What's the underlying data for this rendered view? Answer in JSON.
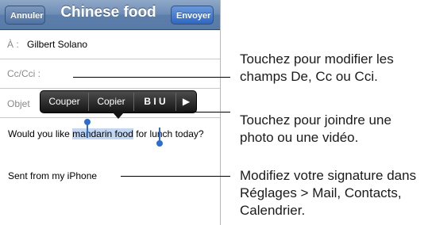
{
  "navbar": {
    "cancel_label": "Annuler",
    "title": "Chinese food",
    "send_label": "Envoyer"
  },
  "fields": {
    "to_label": "À :",
    "to_value": "Gilbert Solano",
    "cc_label": "Cc/Cci :",
    "subject_label": "Objet"
  },
  "edit_menu": {
    "cut": "Couper",
    "copy": "Copier",
    "format": "B I U",
    "more_icon": "play-arrow-icon"
  },
  "message": {
    "before": "Would you like ",
    "selected": "mandarin food",
    "after": " for lunch today?",
    "signature": "Sent from my iPhone"
  },
  "callouts": [
    "Touchez pour modifier les champs De, Cc ou Cci.",
    "Touchez pour joindre une photo ou une vidéo.",
    "Modifiez votre signature dans Réglages > Mail, Contacts, Calendrier."
  ],
  "colors": {
    "navbar": "#6e8db6",
    "send_button": "#2d66c4",
    "selection": "#c3d7f2",
    "handle": "#2e6dd0"
  }
}
